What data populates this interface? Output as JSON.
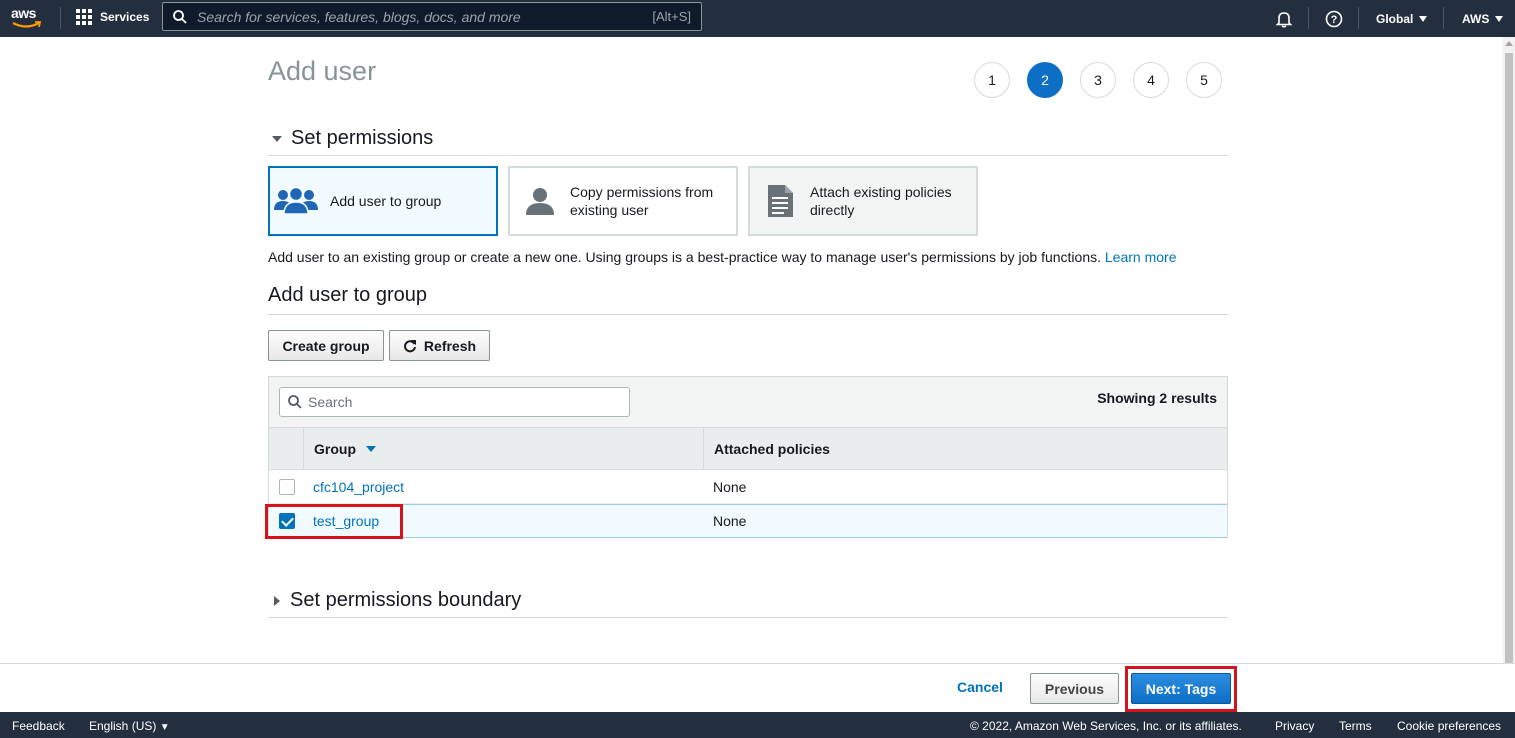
{
  "topnav": {
    "logo_text": "aws",
    "services_label": "Services",
    "search_placeholder": "Search for services, features, blogs, docs, and more",
    "search_shortcut": "[Alt+S]",
    "region": "Global",
    "account": "AWS"
  },
  "page": {
    "title": "Add user",
    "steps": [
      "1",
      "2",
      "3",
      "4",
      "5"
    ],
    "active_step": "2"
  },
  "permissions": {
    "section_title": "Set permissions",
    "options": [
      {
        "label_line1": "Add user to group",
        "label_line2": "",
        "icon": "group-icon"
      },
      {
        "label_line1": "Copy permissions from",
        "label_line2": "existing user",
        "icon": "user-icon"
      },
      {
        "label_line1": "Attach existing policies",
        "label_line2": "directly",
        "icon": "document-icon"
      }
    ],
    "description": "Add user to an existing group or create a new one. Using groups is a best-practice way to manage user's permissions by job functions.",
    "learn_more": "Learn more"
  },
  "group_section": {
    "title": "Add user to group",
    "create_group": "Create group",
    "refresh": "Refresh",
    "search_placeholder": "Search",
    "showing": "Showing 2 results",
    "columns": {
      "group": "Group",
      "policies": "Attached policies"
    },
    "rows": [
      {
        "group": "cfc104_project",
        "policies": "None",
        "checked": false
      },
      {
        "group": "test_group",
        "policies": "None",
        "checked": true
      }
    ]
  },
  "boundary": {
    "title": "Set permissions boundary"
  },
  "actions": {
    "cancel": "Cancel",
    "previous": "Previous",
    "next": "Next: Tags"
  },
  "footer": {
    "feedback": "Feedback",
    "language": "English (US)",
    "copyright": "© 2022, Amazon Web Services, Inc. or its affiliates.",
    "privacy": "Privacy",
    "terms": "Terms",
    "cookie": "Cookie preferences"
  },
  "colors": {
    "nav_bg": "#232f3e",
    "accent_blue": "#0073bb",
    "primary_button": "#0d6ec6",
    "highlight_red": "#d4131d"
  }
}
